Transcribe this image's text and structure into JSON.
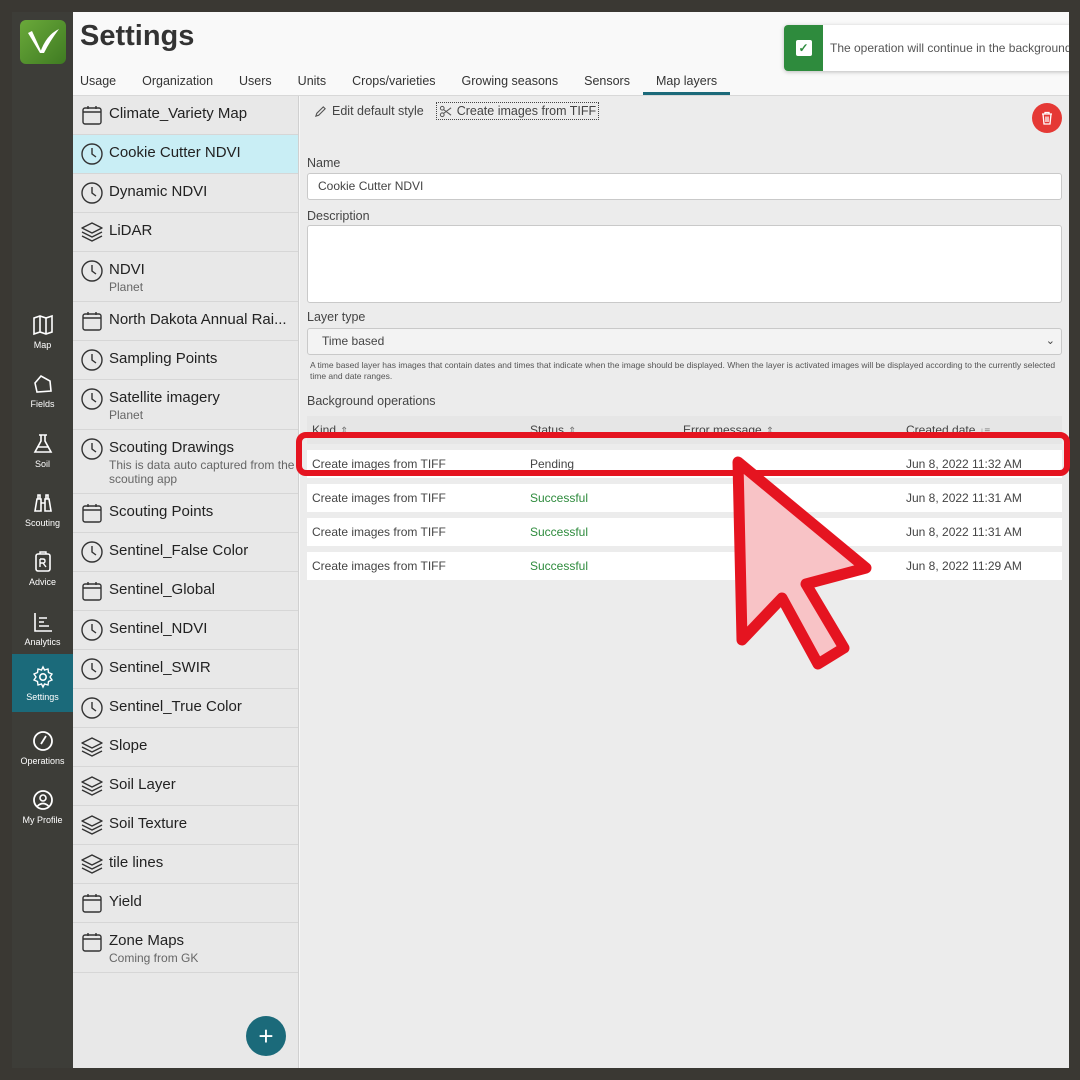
{
  "page": {
    "title": "Settings"
  },
  "tabs": [
    "Usage",
    "Organization",
    "Users",
    "Units",
    "Crops/varieties",
    "Growing seasons",
    "Sensors",
    "Map layers"
  ],
  "active_tab": "Map layers",
  "toast": {
    "message": "The operation will continue in the background",
    "close": "×"
  },
  "rail": {
    "items": [
      {
        "label": "Map",
        "icon": "map-icon"
      },
      {
        "label": "Fields",
        "icon": "fields-icon"
      },
      {
        "label": "Soil",
        "icon": "flask-icon"
      },
      {
        "label": "Scouting",
        "icon": "binoculars-icon"
      },
      {
        "label": "Advice",
        "icon": "prescription-icon"
      },
      {
        "label": "Analytics",
        "icon": "chart-icon"
      },
      {
        "label": "Settings",
        "icon": "gear-icon"
      },
      {
        "label": "Operations",
        "icon": "gauge-icon"
      },
      {
        "label": "My Profile",
        "icon": "profile-icon"
      }
    ],
    "active": "Settings"
  },
  "layers": [
    {
      "name": "Climate_Variety Map",
      "sub": "",
      "icon": "calendar-icon"
    },
    {
      "name": "Cookie Cutter NDVI",
      "sub": "",
      "icon": "clock-icon"
    },
    {
      "name": "Dynamic NDVI",
      "sub": "",
      "icon": "clock-icon"
    },
    {
      "name": "LiDAR",
      "sub": "",
      "icon": "layers-icon"
    },
    {
      "name": "NDVI",
      "sub": "Planet",
      "icon": "clock-icon"
    },
    {
      "name": "North Dakota Annual Rai...",
      "sub": "",
      "icon": "calendar-icon"
    },
    {
      "name": "Sampling Points",
      "sub": "",
      "icon": "clock-icon"
    },
    {
      "name": "Satellite imagery",
      "sub": "Planet",
      "icon": "clock-icon"
    },
    {
      "name": "Scouting Drawings",
      "sub": "This is data auto captured from the scouting app",
      "icon": "clock-icon"
    },
    {
      "name": "Scouting Points",
      "sub": "",
      "icon": "calendar-icon"
    },
    {
      "name": "Sentinel_False Color",
      "sub": "",
      "icon": "clock-icon"
    },
    {
      "name": "Sentinel_Global",
      "sub": "",
      "icon": "calendar-icon"
    },
    {
      "name": "Sentinel_NDVI",
      "sub": "",
      "icon": "clock-icon"
    },
    {
      "name": "Sentinel_SWIR",
      "sub": "",
      "icon": "clock-icon"
    },
    {
      "name": "Sentinel_True Color",
      "sub": "",
      "icon": "clock-icon"
    },
    {
      "name": "Slope",
      "sub": "",
      "icon": "layers-icon"
    },
    {
      "name": "Soil Layer",
      "sub": "",
      "icon": "layers-icon"
    },
    {
      "name": "Soil Texture",
      "sub": "",
      "icon": "layers-icon"
    },
    {
      "name": "tile lines",
      "sub": "",
      "icon": "layers-icon"
    },
    {
      "name": "Yield",
      "sub": "",
      "icon": "calendar-icon"
    },
    {
      "name": "Zone Maps",
      "sub": "Coming from GK",
      "icon": "calendar-icon"
    }
  ],
  "selected_layer": "Cookie Cutter NDVI",
  "add_button": "+",
  "toolbar": {
    "edit_style": "Edit default style",
    "create_images": "Create images from TIFF"
  },
  "form": {
    "name_label": "Name",
    "name_value": "Cookie Cutter NDVI",
    "description_label": "Description",
    "description_value": "",
    "layer_type_label": "Layer type",
    "layer_type_value": "Time based",
    "help_text": "A time based layer has images that contain dates and times that indicate when the image should be displayed. When the layer is activated images will be displayed according to the currently selected time and date ranges."
  },
  "operations": {
    "title": "Background operations",
    "headers": {
      "kind": "Kind",
      "status": "Status",
      "error": "Error message",
      "created": "Created date"
    },
    "rows": [
      {
        "kind": "Create images from TIFF",
        "status": "Pending",
        "error": "",
        "created": "Jun 8, 2022 11:32 AM"
      },
      {
        "kind": "Create images from TIFF",
        "status": "Successful",
        "error": "",
        "created": "Jun 8, 2022 11:31 AM"
      },
      {
        "kind": "Create images from TIFF",
        "status": "Successful",
        "error": "",
        "created": "Jun 8, 2022 11:31 AM"
      },
      {
        "kind": "Create images from TIFF",
        "status": "Successful",
        "error": "",
        "created": "Jun 8, 2022 11:29 AM"
      }
    ]
  },
  "colors": {
    "accent": "#1b6a7a",
    "success": "#2e8b3d",
    "danger": "#e53935",
    "annotation": "#e51420",
    "selected": "#c9eef5"
  }
}
